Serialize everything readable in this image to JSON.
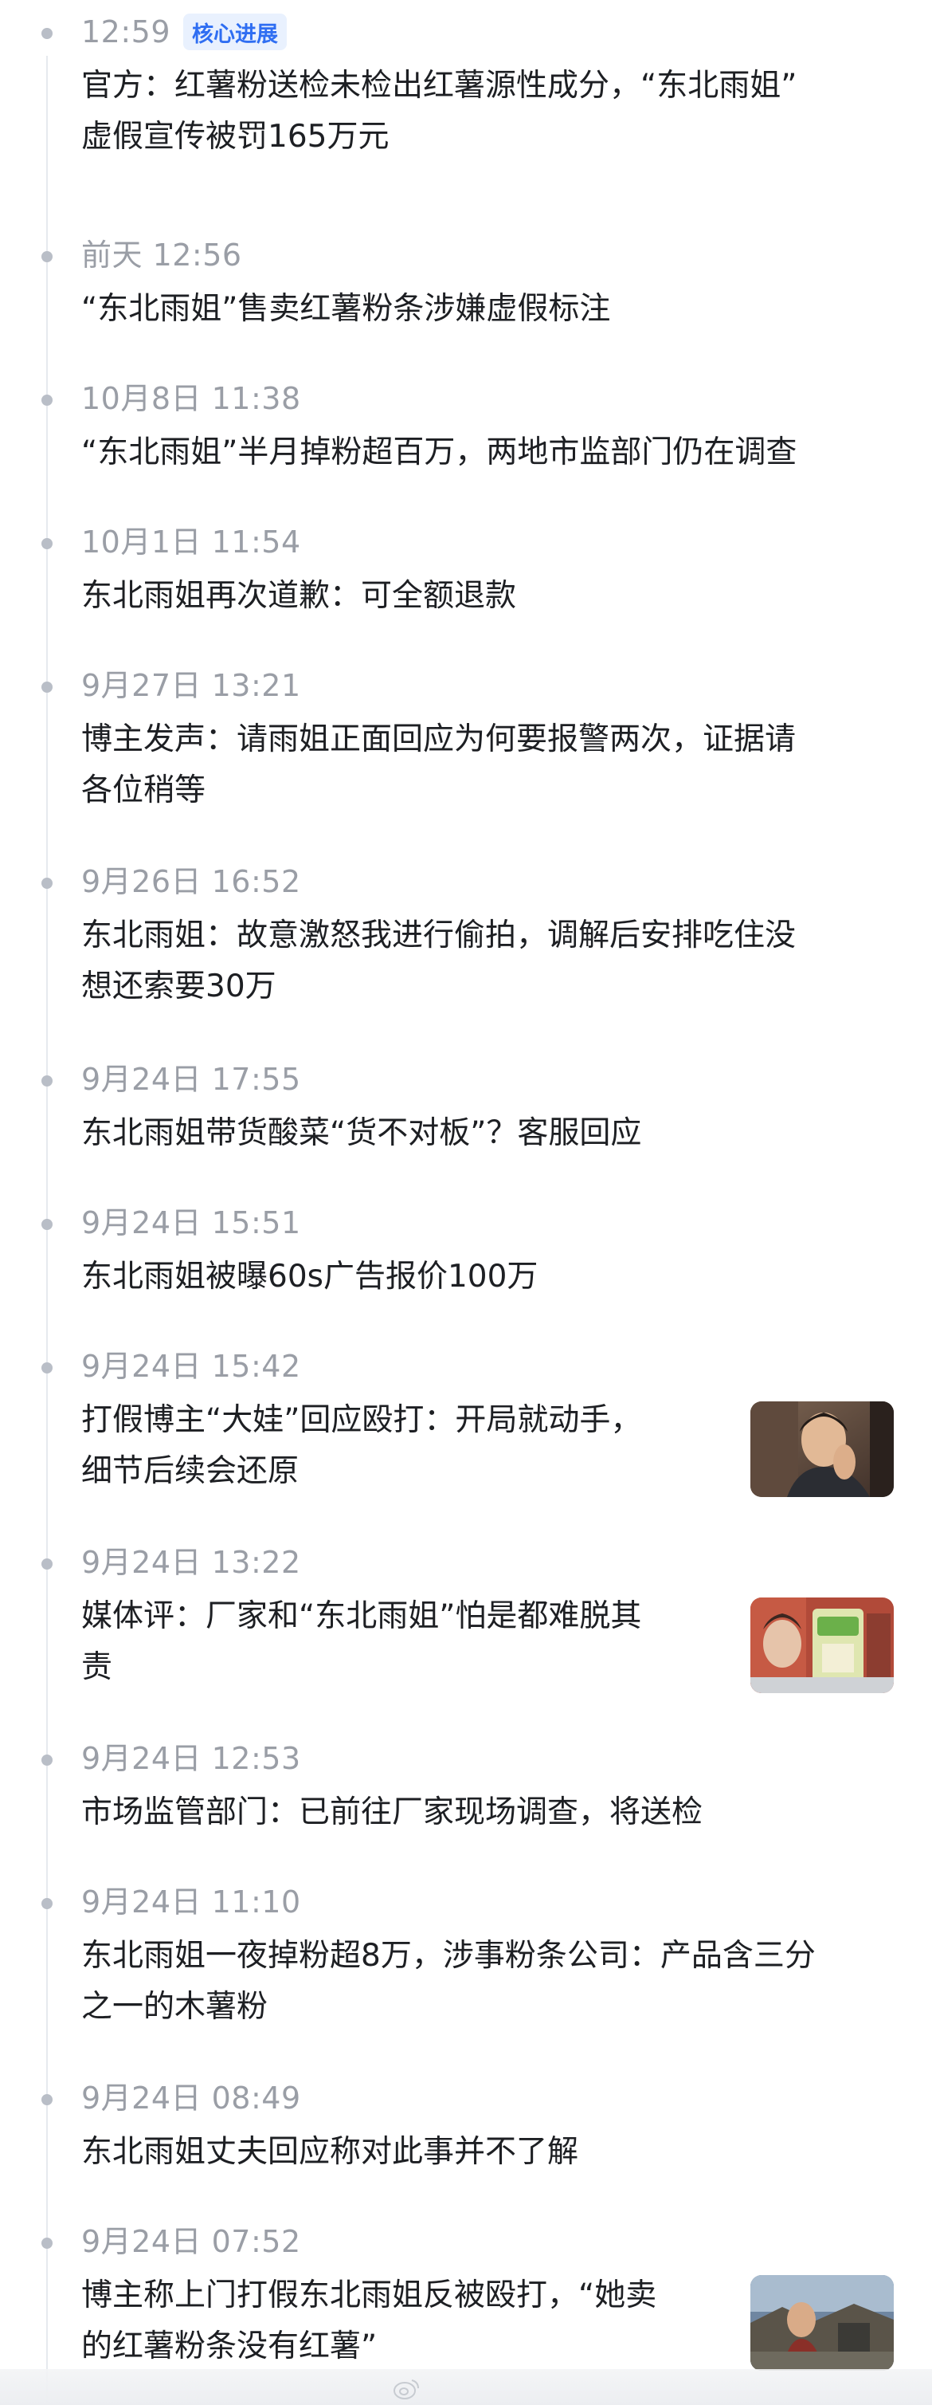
{
  "timeline": {
    "items": [
      {
        "time": "12:59",
        "badge": "核心进展",
        "text": [
          "官方：红薯粉送检未检出红薯源性成分，“东北雨姐”",
          "虚假宣传被罚165万元"
        ]
      },
      {
        "time": "前天 12:56",
        "text": [
          "“东北雨姐”售卖红薯粉条涉嫌虚假标注"
        ]
      },
      {
        "time": "10月8日 11:38",
        "text": [
          "“东北雨姐”半月掉粉超百万，两地市监部门仍在调查"
        ]
      },
      {
        "time": "10月1日 11:54",
        "text": [
          "东北雨姐再次道歉：可全额退款"
        ]
      },
      {
        "time": "9月27日 13:21",
        "text": [
          "博主发声：请雨姐正面回应为何要报警两次，证据请",
          "各位稍等"
        ]
      },
      {
        "time": "9月26日 16:52",
        "text": [
          "东北雨姐：故意激怒我进行偷拍，调解后安排吃住没",
          "想还索要30万"
        ]
      },
      {
        "time": "9月24日 17:55",
        "text": [
          "东北雨姐带货酸菜“货不对板”？客服回应"
        ]
      },
      {
        "time": "9月24日 15:51",
        "text": [
          "东北雨姐被曝60s广告报价100万"
        ]
      },
      {
        "time": "9月24日 15:42",
        "text": [
          "打假博主“大娃”回应殴打：开局就动手，",
          "细节后续会还原"
        ],
        "thumb": "man-video-thumbnail"
      },
      {
        "time": "9月24日 13:22",
        "text": [
          "媒体评：厂家和“东北雨姐”怕是都难脱其",
          "责"
        ],
        "thumb": "product-package-thumbnail"
      },
      {
        "time": "9月24日 12:53",
        "text": [
          "市场监管部门：已前往厂家现场调查，将送检"
        ]
      },
      {
        "time": "9月24日 11:10",
        "text": [
          "东北雨姐一夜掉粉超8万，涉事粉条公司：产品含三分",
          "之一的木薯粉"
        ]
      },
      {
        "time": "9月24日 08:49",
        "text": [
          "东北雨姐丈夫回应称对此事并不了解"
        ]
      },
      {
        "time": "9月24日 07:52",
        "text": [
          "博主称上门打假东北雨姐反被殴打，“她卖",
          "的红薯粉条没有红薯”"
        ],
        "thumb": "outdoor-scene-thumbnail"
      }
    ]
  },
  "colors": {
    "time": "#9a9ea6",
    "headline": "#1d1f23",
    "badge_bg": "#e9f1fe",
    "badge_text": "#2f6ef2",
    "dot": "#b9bec7",
    "line": "#e6e9ee"
  },
  "watermark": {
    "icon": "weibo-watermark-icon"
  }
}
